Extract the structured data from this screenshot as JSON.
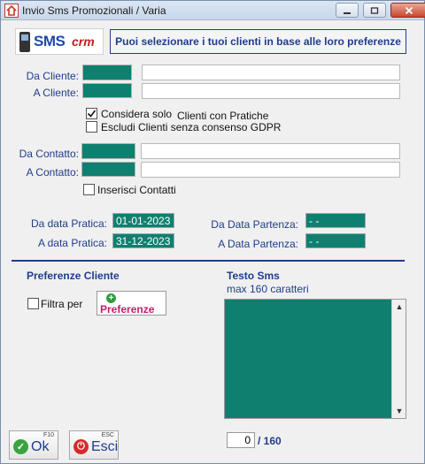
{
  "window": {
    "title": "Invio Sms Promozionali / Varia"
  },
  "logo": {
    "sms": "SMS",
    "crm": "crm"
  },
  "banner": "Puoi selezionare i tuoi clienti in base alle loro preferenze",
  "clienti": {
    "da_label": "Da Cliente:",
    "a_label": "A Cliente:",
    "da_code": "",
    "da_name": "",
    "a_code": "",
    "a_name": ""
  },
  "options": {
    "considera_solo": {
      "label_a": "Considera solo",
      "label_b": "Clienti con Pratiche",
      "checked": true
    },
    "escludi_gdpr": {
      "label": "Escludi Clienti senza consenso GDPR",
      "checked": false
    },
    "inserisci_contatti": {
      "label": "Inserisci Contatti",
      "checked": false
    }
  },
  "contatti": {
    "da_label": "Da Contatto:",
    "a_label": "A Contatto:",
    "da_code": "",
    "da_name": "",
    "a_code": "",
    "a_name": ""
  },
  "date": {
    "da_pratica_label": "Da data Pratica:",
    "da_pratica": "01-01-2023",
    "a_pratica_label": "A data Pratica:",
    "a_pratica": "31-12-2023",
    "da_partenza_label": "Da Data Partenza:",
    "da_partenza": "- -",
    "a_partenza_label": "A Data Partenza:",
    "a_partenza": "- -"
  },
  "preferenze": {
    "title": "Preferenze Cliente",
    "filtra_label": "Filtra per",
    "filtra_checked": false,
    "button_label": "Preferenze"
  },
  "sms": {
    "title": "Testo Sms",
    "subtitle": "max 160 caratteri",
    "text": "",
    "count": "0",
    "max": "/ 160"
  },
  "buttons": {
    "ok": {
      "label": "Ok",
      "key": "F10"
    },
    "esci": {
      "label": "Esci",
      "key": "ESC"
    }
  },
  "colors": {
    "accent": "#1f3d8c",
    "field_teal": "#0f8070",
    "preferenze_text": "#c81a6a"
  }
}
